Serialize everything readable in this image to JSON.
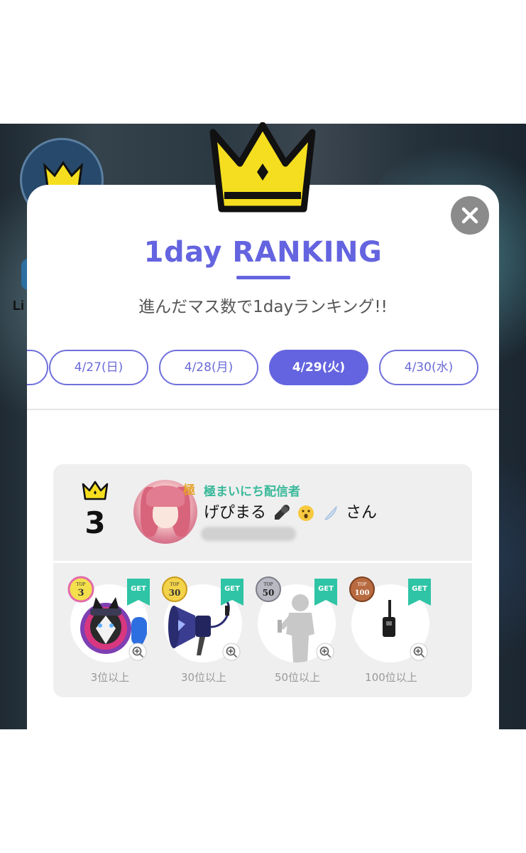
{
  "background": {
    "partial_label": "Li"
  },
  "modal": {
    "title": "1day RANKING",
    "subtitle": "進んだマス数で1dayランキング!!",
    "tabs": [
      {
        "label": "",
        "active": false
      },
      {
        "label": "4/27(日)",
        "active": false
      },
      {
        "label": "4/28(月)",
        "active": false
      },
      {
        "label": "4/29(火)",
        "active": true
      },
      {
        "label": "4/30(水)",
        "active": false
      }
    ],
    "entry": {
      "rank": "3",
      "badge": "極",
      "rank_title": "極まいにち配信者",
      "username": "げぴまる",
      "honorific": "さん"
    },
    "rewards": [
      {
        "medal": "3",
        "caption": "3位以上",
        "get_label": "GET",
        "icon": "husky-icon",
        "medal_color": "#f4e04d"
      },
      {
        "medal": "30",
        "caption": "30位以上",
        "get_label": "GET",
        "icon": "megaphone-icon",
        "medal_color": "#f3d34a"
      },
      {
        "medal": "50",
        "caption": "50位以上",
        "get_label": "GET",
        "icon": "silhouette-icon",
        "medal_color": "#b9b9c3"
      },
      {
        "medal": "100",
        "caption": "100位以上",
        "get_label": "GET",
        "icon": "microphone-icon",
        "medal_color": "#b86a40"
      }
    ]
  },
  "colors": {
    "accent": "#6464e0",
    "card": "#efefef",
    "get_ribbon": "#2ec4a5",
    "crown": "#f5de1f"
  }
}
